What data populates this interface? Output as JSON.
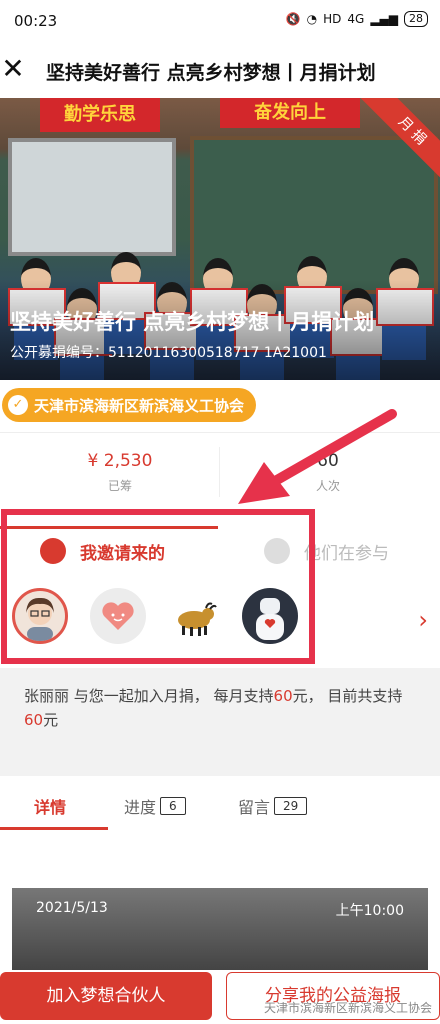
{
  "status": {
    "time": "00:23",
    "network": "HD",
    "signal": "4G",
    "battery": "28"
  },
  "nav": {
    "title": "坚持美好善行 点亮乡村梦想丨月捐计划"
  },
  "hero": {
    "banner_left": "勤学乐思",
    "banner_right": "奋发向上",
    "ribbon": "月 捐",
    "title": "坚持美好善行 点亮乡村梦想丨月捐计划",
    "code": "公开募捐编号：51120116300518717 1A21001"
  },
  "org": {
    "name": "天津市滨海新区新滨海义工协会"
  },
  "stats": {
    "raised_value": "¥ 2,530",
    "raised_label": "已筹",
    "count_value": "60",
    "count_label": "人次"
  },
  "invite": {
    "tab_invited": "我邀请来的",
    "tab_participants": "他们在参与"
  },
  "message": {
    "text_before": "张丽丽 与您一起加入月捐， 每月支持",
    "amount1": "60",
    "text_mid": "元， 目前共支持",
    "amount2": "60",
    "text_after": "元"
  },
  "tabs": [
    {
      "label": "详情"
    },
    {
      "label": "进度",
      "badge": "6"
    },
    {
      "label": "留言",
      "badge": "29"
    }
  ],
  "photo": {
    "date": "2021/5/13",
    "time": "上午10:00"
  },
  "buttons": {
    "join": "加入梦想合伙人",
    "share": "分享我的公益海报"
  },
  "watermark": "天津市滨海新区新滨海义工协会",
  "colors": {
    "accent": "#d83a2f",
    "org_pill": "#f5a623",
    "highlight": "#e6324b"
  }
}
